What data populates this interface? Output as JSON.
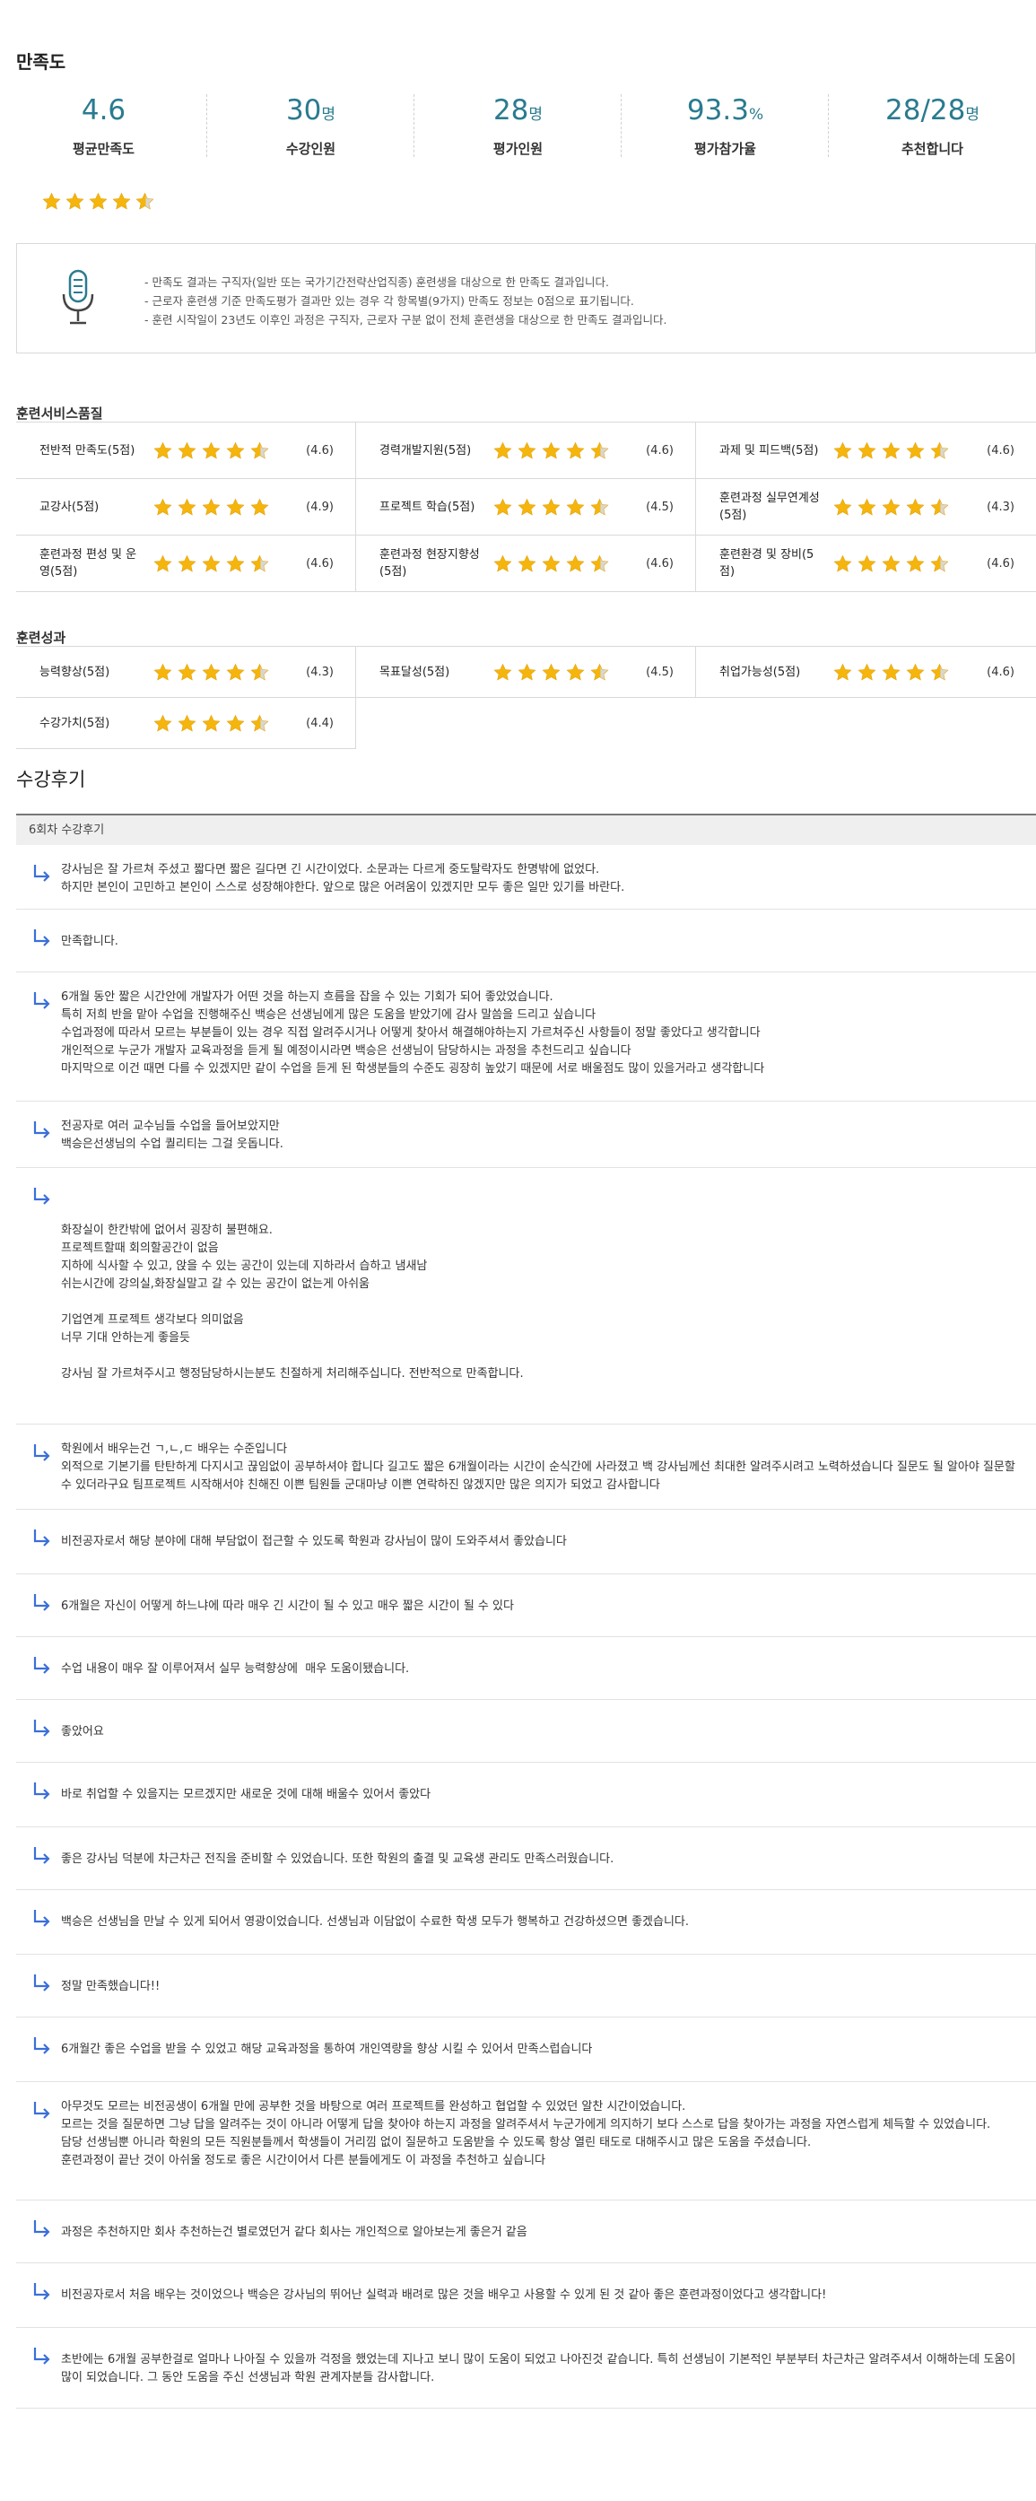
{
  "satisfaction": {
    "title": "만족도",
    "stats": [
      {
        "value": "4.6",
        "unit": "",
        "label": "평균만족도"
      },
      {
        "value": "30",
        "unit": "명",
        "label": "수강인원"
      },
      {
        "value": "28",
        "unit": "명",
        "label": "평가인원"
      },
      {
        "value": "93.3",
        "unit": "%",
        "label": "평가참가율"
      },
      {
        "value": "28/28",
        "unit": "명",
        "label": "추천합니다"
      }
    ],
    "overall_rating": 4.6
  },
  "colors": {
    "accent": "#2a7b8f",
    "star": "#f5b50c",
    "star_empty": "#d7d7d7",
    "arrow": "#3a6fd8"
  },
  "notice": {
    "icon": "microphone-icon",
    "lines": [
      "- 만족도 결과는 구직자(일반 또는 국가기간전략산업직종) 훈련생을 대상으로 한 만족도 결과입니다.",
      "- 근로자 훈련생 기준 만족도평가 결과만 있는 경우 각 항목별(9가지) 만족도 정보는 0점으로 표기됩니다.",
      "- 훈련 시작일이 23년도 이후인 과정은 구직자, 근로자 구분 없이 전체 훈련생을 대상으로 한 만족도 결과입니다."
    ]
  },
  "training_service": {
    "title": "훈련서비스품질",
    "rows": [
      [
        {
          "name": "전반적 만족도(5점)",
          "rating": 4.6,
          "score": "(4.6)"
        },
        {
          "name": "경력개발지원(5점)",
          "rating": 4.6,
          "score": "(4.6)"
        },
        {
          "name": "과제 및 피드백(5점)",
          "rating": 4.6,
          "score": "(4.6)"
        }
      ],
      [
        {
          "name": "교강사(5점)",
          "rating": 4.9,
          "score": "(4.9)"
        },
        {
          "name": "프로젝트 학습(5점)",
          "rating": 4.5,
          "score": "(4.5)"
        },
        {
          "name": "훈련과정 실무연계성(5점)",
          "rating": 4.3,
          "score": "(4.3)"
        }
      ],
      [
        {
          "name": "훈련과정 편성 및 운영(5점)",
          "rating": 4.6,
          "score": "(4.6)"
        },
        {
          "name": "훈련과정 현장지향성(5점)",
          "rating": 4.6,
          "score": "(4.6)"
        },
        {
          "name": "훈련환경 및 장비(5점)",
          "rating": 4.6,
          "score": "(4.6)"
        }
      ]
    ]
  },
  "training_result": {
    "title": "훈련성과",
    "rows": [
      [
        {
          "name": "능력향상(5점)",
          "rating": 4.3,
          "score": "(4.3)"
        },
        {
          "name": "목표달성(5점)",
          "rating": 4.5,
          "score": "(4.5)"
        },
        {
          "name": "취업가능성(5점)",
          "rating": 4.6,
          "score": "(4.6)"
        }
      ],
      [
        {
          "name": "수강가치(5점)",
          "rating": 4.4,
          "score": "(4.4)"
        }
      ]
    ]
  },
  "reviews": {
    "title": "수강후기",
    "session_label": "6회차 수강후기",
    "items": [
      [
        "강사님은 잘 가르쳐 주셨고 짧다면 짧은 길다면 긴 시간이었다. 소문과는 다르게 중도탈락자도 한명밖에 없었다.",
        "하지만 본인이 고민하고 본인이 스스로 성장해야한다. 앞으로 많은 어려움이 있겠지만 모두 좋은 일만 있기를 바란다."
      ],
      [
        "만족합니다."
      ],
      [
        "6개월 동안 짧은 시간안에 개발자가 어떤 것을 하는지 흐름을 잡을 수 있는 기회가 되어 좋았었습니다.",
        "특히 저희 반을 맡아 수업을 진행해주신 백승은 선생님에게 많은 도움을 받았기에 감사 말씀을 드리고 싶습니다",
        "수업과정에 따라서 모르는 부분들이 있는 경우 직접 알려주시거나 어떻게 찾아서 해결해야하는지 가르쳐주신 사항들이 정말 좋았다고 생각합니다",
        "개인적으로 누군가 개발자 교육과정을 듣게 될 예정이시라면 백승은 선생님이 담당하시는 과정을 추천드리고 싶습니다",
        "마지막으로 이건 때면 다를 수 있겠지만 같이 수업을 듣게 된 학생분들의 수준도 굉장히 높았기 때문에 서로 배울점도 많이 있을거라고 생각합니다"
      ],
      [
        "전공자로 여러 교수님들 수업을 들어보았지만",
        "백승은선생님의 수업 퀄리티는 그걸 웃돕니다."
      ],
      [
        "",
        "화장실이 한칸밖에 없어서 굉장히 불편해요.",
        "프로젝트할때 회의할공간이 없음",
        "지하에 식사할 수 있고, 앉을 수 있는 공간이 있는데 지하라서 습하고 냄새남",
        "쉬는시간에 강의실,화장실말고 갈 수 있는 공간이 없는게 아쉬움",
        "",
        "기업연계 프로젝트 생각보다 의미없음",
        "너무 기대 안하는게 좋을듯",
        "",
        "강사님 잘 가르쳐주시고 행정담당하시는분도 친절하게 처리해주십니다. 전반적으로 만족합니다."
      ],
      [
        "학원에서 배우는건 ㄱ,ㄴ,ㄷ 배우는 수준입니다",
        "외적으로 기본기를 탄탄하게 다지시고 끊임없이 공부하셔야 합니다 길고도 짧은 6개월이라는 시간이 순식간에 사라졌고 백 강사님께선 최대한 알려주시려고 노력하셨습니다 질문도 될 알아야 질문할 수 있더라구요 팀프로젝트 시작해서야 친해진 이쁜 팀원들 군대마냥 이쁜 연락하진 않겠지만 많은 의지가 되었고 감사합니다"
      ],
      [
        "비전공자로서 해당 분야에 대해 부담없이 접근할 수 있도록 학원과 강사님이 많이 도와주셔서 좋았습니다"
      ],
      [
        "6개월은 자신이 어떻게 하느냐에 따라 매우 긴 시간이 될 수 있고 매우 짧은 시간이 될 수 있다"
      ],
      [
        "수업 내용이 매우 잘 이루어져서 실무 능력향상에  매우 도움이됐습니다."
      ],
      [
        "좋았어요"
      ],
      [
        "바로 취업할 수 있을지는 모르겠지만 새로운 것에 대해 배울수 있어서 좋았다"
      ],
      [
        "좋은 강사님 덕분에 차근차근 전직을 준비할 수 있었습니다. 또한 학원의 출결 및 교육생 관리도 만족스러웠습니다."
      ],
      [
        "백승은 선생님을 만날 수 있게 되어서 영광이었습니다. 선생님과 이담없이 수료한 학생 모두가 행복하고 건강하셨으면 좋겠습니다."
      ],
      [
        "정말 만족했습니다!!"
      ],
      [
        "6개월간 좋은 수업을 받을 수 있었고 해당 교육과정을 통하여 개인역량을 향상 시킬 수 있어서 만족스럽습니다"
      ],
      [
        "아무것도 모르는 비전공생이 6개월 만에 공부한 것을 바탕으로 여러 프로젝트를 완성하고 협업할 수 있었던 알찬 시간이었습니다.",
        "모르는 것을 질문하면 그냥 답을 알려주는 것이 아니라 어떻게 답을 찾아야 하는지 과정을 알려주셔서 누군가에게 의지하기 보다 스스로 답을 찾아가는 과정을 자연스럽게 체득할 수 있었습니다.",
        "담당 선생님뿐 아니라 학원의 모든 직원분들께서 학생들이 거리낌 없이 질문하고 도움받을 수 있도록 항상 열린 태도로 대해주시고 많은 도움을 주셨습니다.",
        "훈련과정이 끝난 것이 아쉬울 정도로 좋은 시간이어서 다른 분들에게도 이 과정을 추천하고 싶습니다"
      ],
      [
        "과정은 추천하지만 회사 추천하는건 별로였던거 같다 회사는 개인적으로 알아보는게 좋은거 같음"
      ],
      [
        "비전공자로서 처음 배우는 것이었으나 백승은 강사님의 뛰어난 실력과 배려로 많은 것을 배우고 사용할 수 있게 된 것 같아 좋은 훈련과정이었다고 생각합니다!"
      ],
      [
        "초반에는 6개월 공부한걸로 얼마나 나아질 수 있을까 걱정을 했었는데 지나고 보니 많이 도움이 되었고 나아진것 같습니다. 특히 선생님이 기본적인 부분부터 차근차근 알려주셔서 이해하는데 도움이 많이 되었습니다. 그 동안 도움을 주신 선생님과 학원 관계자분들 감사합니다."
      ]
    ]
  }
}
